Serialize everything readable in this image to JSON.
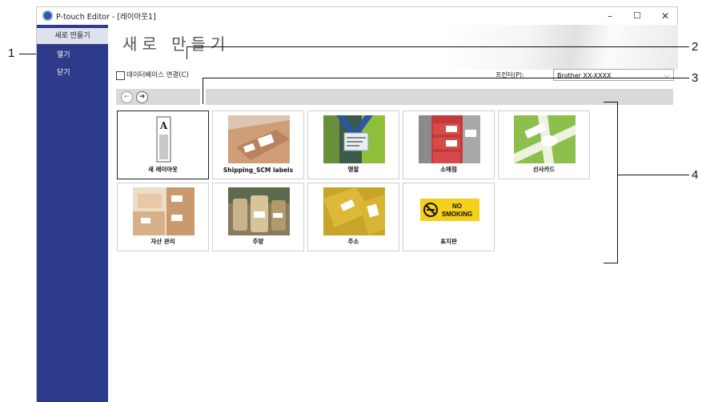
{
  "window": {
    "title": "P-touch Editor - [레이아웃1]",
    "minimize": "–",
    "maximize": "☐",
    "close": "✕"
  },
  "sidebar": {
    "items": [
      {
        "label": "새로 만들기"
      },
      {
        "label": "열기"
      },
      {
        "label": "닫기"
      }
    ]
  },
  "main": {
    "title": "새로 만들기",
    "db_connect_label": "데이터베이스 연결(C)",
    "printer_label": "프린터(P):",
    "printer_value": "Brother XX-XXXX",
    "back_glyph": "←",
    "forward_glyph": "➜"
  },
  "templates": [
    {
      "label": "새 레이아웃"
    },
    {
      "label": "Shipping_SCM labels"
    },
    {
      "label": "명찰"
    },
    {
      "label": "소매점"
    },
    {
      "label": "선사카드"
    },
    {
      "label": "자산 관리"
    },
    {
      "label": "주방"
    },
    {
      "label": "주소"
    },
    {
      "label": "표지판"
    }
  ],
  "thumbs": {
    "new_layout_letter": "A",
    "sign_text_1": "NO",
    "sign_text_2": "SMOKING"
  },
  "callouts": {
    "c1": "1",
    "c2": "2",
    "c3": "3",
    "c4": "4"
  }
}
